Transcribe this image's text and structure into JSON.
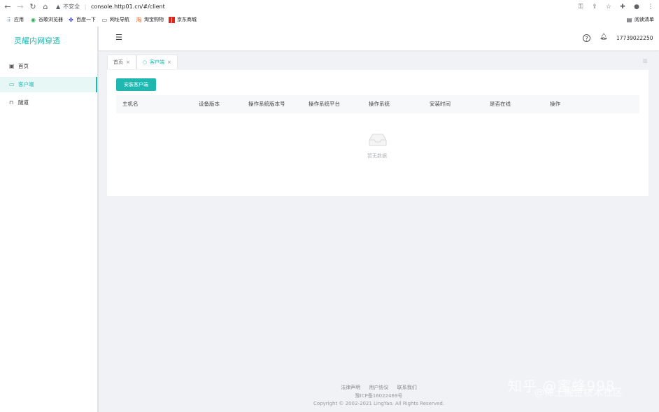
{
  "browser": {
    "security_label": "不安全",
    "url": "console.http01.cn/#/client",
    "bookmarks": [
      {
        "label": "应用",
        "icon": "apps-icon"
      },
      {
        "label": "谷歌浏览器",
        "icon": "chrome-icon"
      },
      {
        "label": "百度一下",
        "icon": "baidu-icon"
      },
      {
        "label": "网址导航",
        "icon": "nav-icon"
      },
      {
        "label": "淘宝购物",
        "icon": "taobao-icon"
      },
      {
        "label": "京东商城",
        "icon": "jd-icon"
      }
    ],
    "reading_list": "阅读清单"
  },
  "sidebar": {
    "brand": "灵耀内网穿透",
    "items": [
      {
        "label": "首页",
        "icon": "home-icon"
      },
      {
        "label": "客户端",
        "icon": "monitor-icon"
      },
      {
        "label": "隧道",
        "icon": "tunnel-icon"
      }
    ]
  },
  "header": {
    "phone": "17739022250"
  },
  "tabs": [
    {
      "label": "首页"
    },
    {
      "label": "客户端"
    }
  ],
  "main": {
    "install_button": "安装客户端",
    "columns": [
      "主机名",
      "设备版本",
      "操作系统版本号",
      "操作系统平台",
      "操作系统",
      "安装时间",
      "是否在线",
      "操作"
    ],
    "empty_text": "暂无数据"
  },
  "footer": {
    "links": [
      "法律声明",
      "用户协议",
      "联系我们"
    ],
    "icp": "豫ICP备16022469号",
    "copyright": "Copyright © 2002-2021 LingYao. All Rights Reserved."
  },
  "watermark": {
    "line1": "知乎 @蜜蜂998",
    "line2": "@稀土掘金技术社区"
  },
  "colors": {
    "accent": "#1fb8b0",
    "background": "#f0f2f5"
  }
}
